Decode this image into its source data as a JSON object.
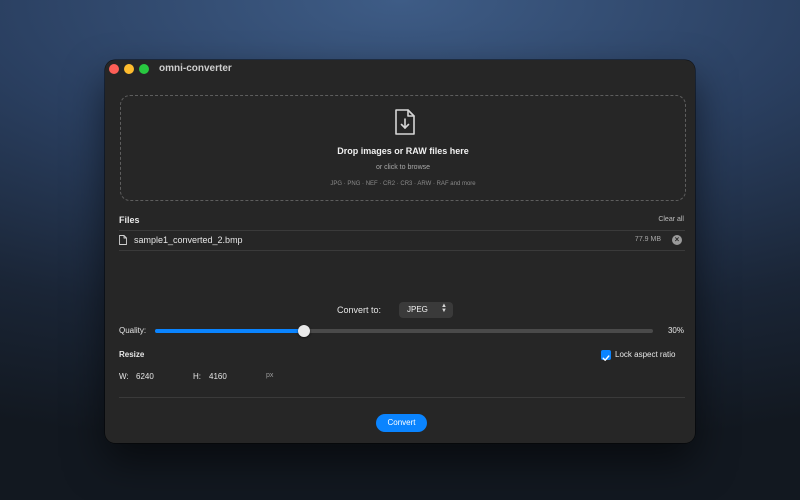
{
  "window": {
    "title": "omni-converter"
  },
  "dropzone": {
    "icon": "file-download-icon",
    "title": "Drop images or RAW files here",
    "subtitle": "or click to browse",
    "formats": "JPG · PNG · NEF · CR2 · CR3 · ARW · RAF and more"
  },
  "files": {
    "label": "Files",
    "clear_label": "Clear all",
    "items": [
      {
        "name": "sample1_converted_2.bmp",
        "size": "77.9 MB",
        "icon": "file-icon",
        "remove_icon": "close-circle-icon"
      }
    ]
  },
  "convert_to": {
    "label": "Convert to:",
    "selected": "JPEG",
    "icon": "chevron-updown-icon"
  },
  "quality": {
    "label": "Quality:",
    "value": 30,
    "display": "30%"
  },
  "resize": {
    "label": "Resize",
    "lock_label": "Lock aspect ratio",
    "lock_checked": true,
    "width_label": "W:",
    "width": "6240",
    "height_label": "H:",
    "height": "4160",
    "unit": "px"
  },
  "actions": {
    "convert_label": "Convert"
  },
  "colors": {
    "accent": "#0a84ff",
    "window_bg": "#262626"
  }
}
